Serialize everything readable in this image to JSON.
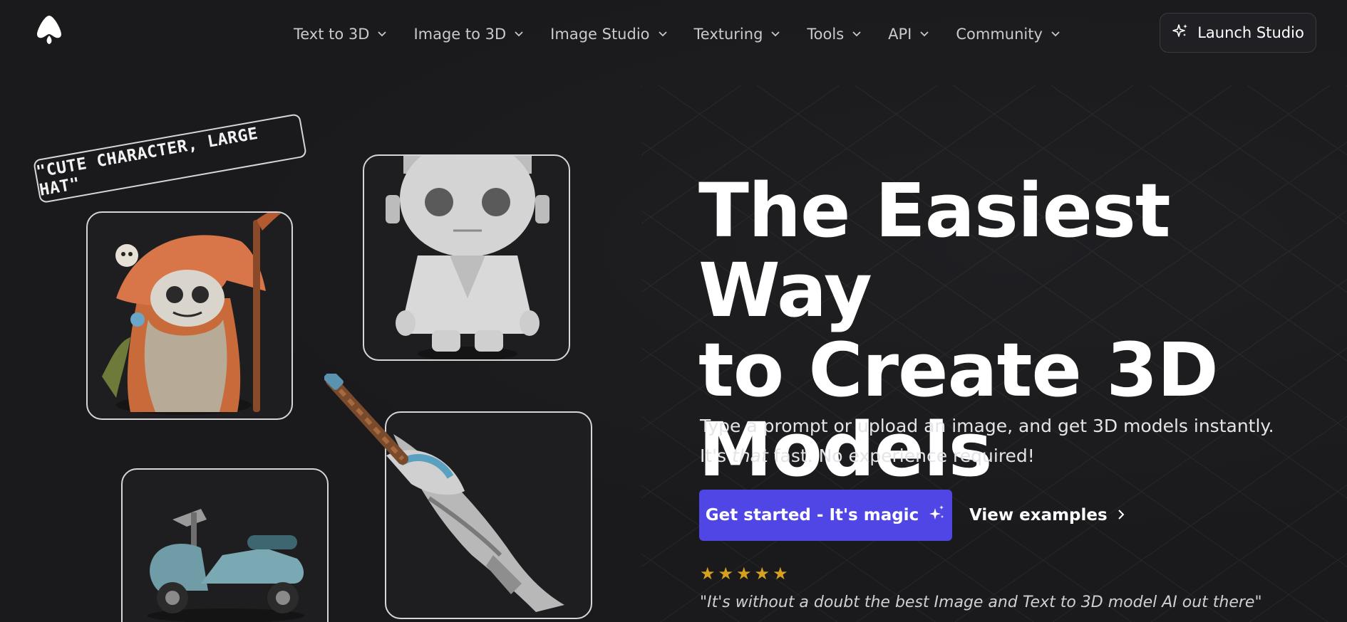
{
  "nav": {
    "logo_icon": "tripo-logo-icon",
    "items": [
      {
        "label": "Text to 3D"
      },
      {
        "label": "Image to 3D"
      },
      {
        "label": "Image Studio"
      },
      {
        "label": "Texturing"
      },
      {
        "label": "Tools"
      },
      {
        "label": "API"
      },
      {
        "label": "Community"
      }
    ],
    "launch_label": "Launch Studio",
    "launch_icon": "sparkle-icon"
  },
  "showcase": {
    "prompt_tag": "\"CUTE CHARACTER, LARGE HAT\""
  },
  "hero": {
    "title_line1": "The Easiest Way",
    "title_line2": "to Create 3D",
    "title_line3": "Models",
    "subtitle_line1": "Type a prompt or upload an image, and get 3D models instantly.",
    "subtitle_line2_pre": "It's ",
    "subtitle_line2_em": "that",
    "subtitle_line2_post": " fast. No experience required!",
    "cta_primary": "Get started - It's magic",
    "cta_secondary": "View examples",
    "rating_stars": 5,
    "quote": "\"It's without a doubt the best Image and Text to 3D model AI out there\""
  },
  "colors": {
    "background": "#1a1a1c",
    "accent": "#4f46e5",
    "star": "#d6a21e"
  }
}
